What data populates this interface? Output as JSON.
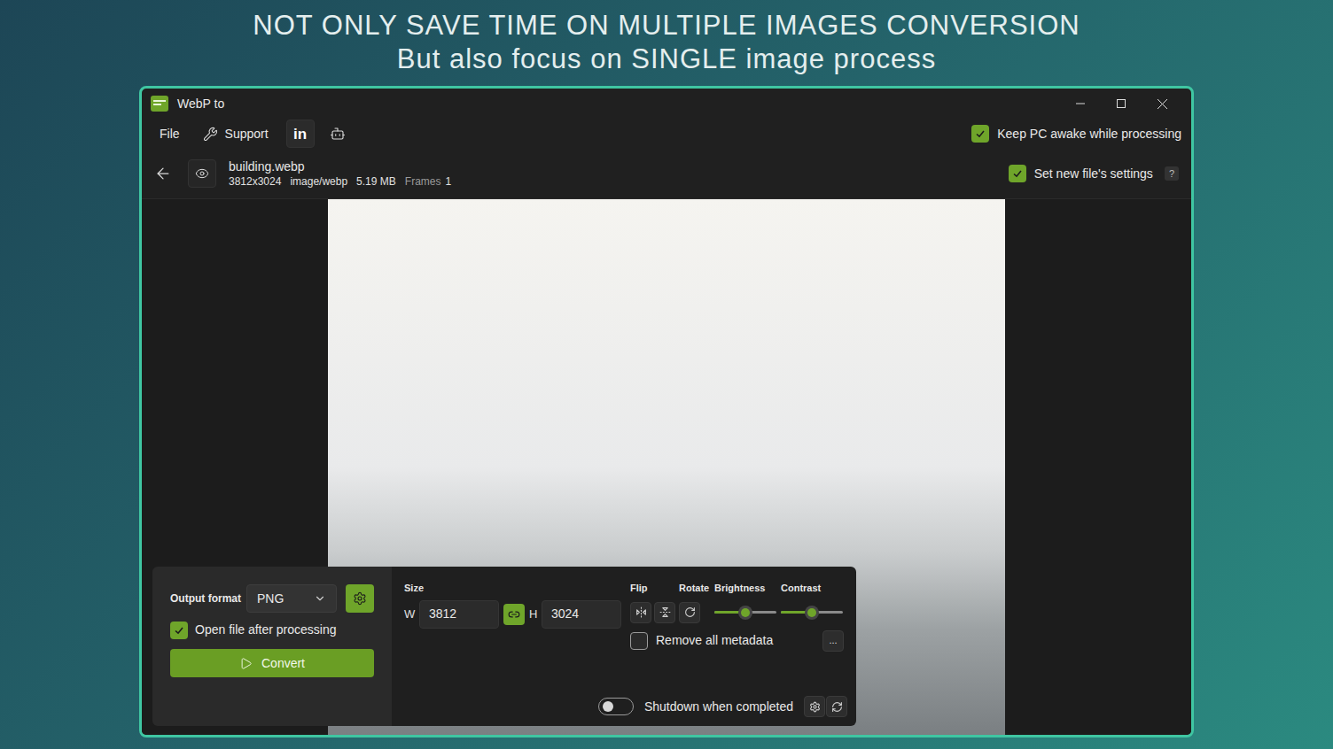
{
  "headline": {
    "line1": "NOT ONLY SAVE TIME ON MULTIPLE IMAGES CONVERSION",
    "line2": "But also focus on SINGLE image process"
  },
  "window": {
    "title": "WebP to"
  },
  "menu": [
    {
      "label": "File"
    },
    {
      "label": "Support"
    }
  ],
  "social": {
    "linkedin": "in"
  },
  "keep_awake": {
    "label": "Keep PC awake while processing",
    "checked": true
  },
  "file": {
    "name": "building.webp",
    "dimensions": "3812x3024",
    "type": "image/webp",
    "size": "5.19 MB",
    "frames_label": "Frames",
    "frames": "1"
  },
  "set_new_settings": {
    "label": "Set new file's settings",
    "checked": true,
    "help": "?"
  },
  "output": {
    "label": "Output format",
    "value": "PNG"
  },
  "open_after": {
    "label": "Open file after processing",
    "checked": true
  },
  "convert": {
    "label": "Convert"
  },
  "size": {
    "label": "Size",
    "w_label": "W",
    "width": "3812",
    "h_label": "H",
    "height": "3024",
    "linked": true
  },
  "transform": {
    "flip": "Flip",
    "rotate": "Rotate"
  },
  "sliders": [
    {
      "label": "Brightness",
      "level": 0.5
    },
    {
      "label": "Contrast",
      "level": 0.5
    }
  ],
  "remove_metadata": {
    "label": "Remove all metadata",
    "checked": false
  },
  "more": {
    "label": "..."
  },
  "shutdown": {
    "label": "Shutdown when completed",
    "on": false
  }
}
